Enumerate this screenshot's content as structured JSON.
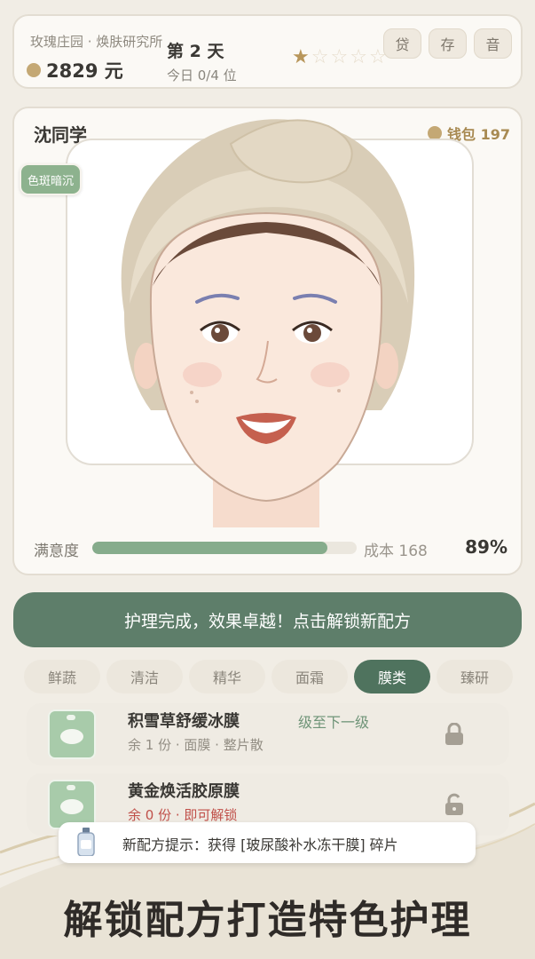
{
  "header": {
    "shop_name": "玫瑰庄园 · 焕肤研究所",
    "money": "2829 元",
    "day": "第 2 天",
    "day_progress": "今日 0/4 位",
    "rating": 1,
    "rating_max": 5,
    "buttons": [
      "贷",
      "存",
      "音"
    ]
  },
  "customer": {
    "name": "沈同学",
    "wallet": "钱包 197",
    "skin_tag": "色斑暗沉",
    "satisfaction_label": "满意度",
    "satisfaction_value": 0.89,
    "cost": "成本 168",
    "satisfaction_pct": "89%"
  },
  "banner": "护理完成，效果卓越！点击解锁新配方",
  "tabs": [
    {
      "label": "鲜蔬",
      "active": false
    },
    {
      "label": "清洁",
      "active": false
    },
    {
      "label": "精华",
      "active": false
    },
    {
      "label": "面霜",
      "active": false
    },
    {
      "label": "膜类",
      "active": true
    },
    {
      "label": "臻研",
      "active": false
    }
  ],
  "recipes": [
    {
      "name": "积雪草舒缓冰膜",
      "sub": "余 1 份 · 面膜 · 整片散",
      "level": "级至下一级",
      "locked": true
    },
    {
      "name": "黄金焕活胶原膜",
      "sub": "余 0 份 · 即可解锁",
      "level": "",
      "locked": false
    }
  ],
  "hint": "新配方提示：获得 [玻尿酸补水冻干膜] 碎片",
  "slogan": "解锁配方打造特色护理",
  "colors": {
    "accent_green": "#5e7e6a",
    "tab_active": "#4f735e",
    "coin": "#c4a874",
    "satisfaction_fill": "#86ac8c",
    "warning_red": "#c0504a"
  }
}
